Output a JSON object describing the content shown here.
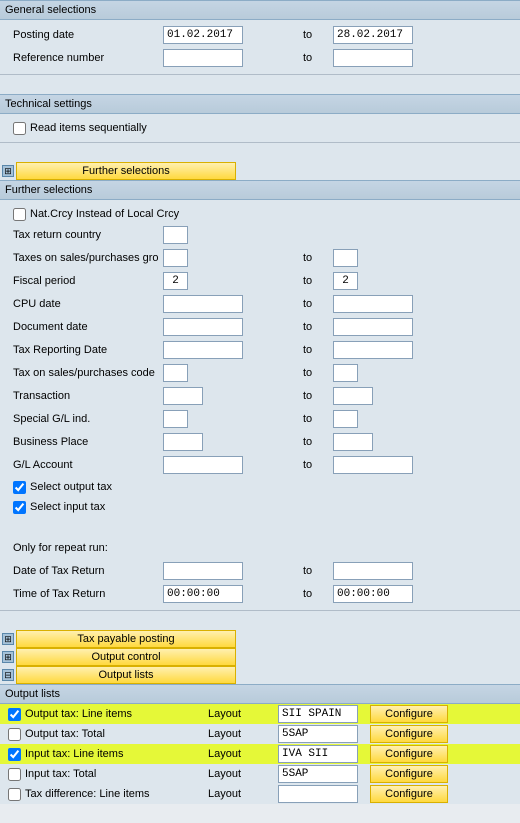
{
  "sections": {
    "general": {
      "title": "General selections",
      "posting_date_label": "Posting date",
      "posting_date_from": "01.02.2017",
      "posting_date_to_label": "to",
      "posting_date_to": "28.02.2017",
      "reference_label": "Reference number",
      "reference_from": "",
      "reference_to_label": "to",
      "reference_to": ""
    },
    "technical": {
      "title": "Technical settings",
      "read_seq_label": "Read items sequentially"
    },
    "further": {
      "button": "Further selections",
      "title": "Further selections",
      "nat_crcy_label": "Nat.Crcy Instead of Local Crcy",
      "tax_return_country_label": "Tax return country",
      "taxes_gro_label": "Taxes on sales/purchases gro",
      "fiscal_period_label": "Fiscal period",
      "fiscal_period_from": "2",
      "fiscal_period_to": "2",
      "cpu_date_label": "CPU date",
      "doc_date_label": "Document date",
      "tax_report_date_label": "Tax Reporting Date",
      "tax_code_label": "Tax on sales/purchases code",
      "transaction_label": "Transaction",
      "special_gl_label": "Special G/L ind.",
      "business_place_label": "Business Place",
      "gl_account_label": "G/L Account",
      "select_output_label": "Select output tax",
      "select_input_label": "Select input tax",
      "repeat_run_label": "Only for repeat run:",
      "date_return_label": "Date of Tax Return",
      "time_return_label": "Time of Tax Return",
      "time_from": "00:00:00",
      "time_to": "00:00:00",
      "to_label": "to"
    },
    "buttons": {
      "tax_payable": "Tax payable posting",
      "output_control": "Output control",
      "output_lists": "Output lists"
    },
    "output_lists": {
      "title": "Output lists",
      "layout_label": "Layout",
      "configure_label": "Configure",
      "rows": {
        "output_line": {
          "label": "Output tax: Line items",
          "value": "SII SPAIN",
          "checked": true,
          "highlight": true
        },
        "output_total": {
          "label": "Output tax: Total",
          "value": "5SAP",
          "checked": false,
          "highlight": false
        },
        "input_line": {
          "label": "Input tax: Line items",
          "value": "IVA SII",
          "checked": true,
          "highlight": true
        },
        "input_total": {
          "label": "Input tax: Total",
          "value": "5SAP",
          "checked": false,
          "highlight": false
        },
        "tax_diff": {
          "label": "Tax difference: Line items",
          "value": "",
          "checked": false,
          "highlight": false
        }
      }
    }
  }
}
